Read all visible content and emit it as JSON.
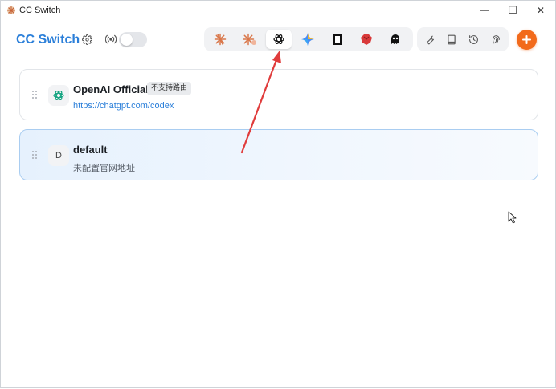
{
  "window": {
    "title": "CC Switch",
    "minimize_glyph": "—",
    "maximize_glyph": "☐",
    "close_glyph": "✕"
  },
  "header": {
    "brand": "CC Switch",
    "settings_icon": "gear-icon",
    "proxy_icon": "broadcast-icon",
    "proxy_toggle_on": false
  },
  "apps": [
    {
      "name": "claude",
      "icon": "claude-icon",
      "active": false
    },
    {
      "name": "claude-alt",
      "icon": "claude-alt-icon",
      "active": false
    },
    {
      "name": "openai",
      "icon": "openai-icon",
      "active": true
    },
    {
      "name": "gemini",
      "icon": "gemini-icon",
      "active": false
    },
    {
      "name": "opencode",
      "icon": "opencode-icon",
      "active": false
    },
    {
      "name": "redbird",
      "icon": "red-bird-icon",
      "active": false
    },
    {
      "name": "ghost",
      "icon": "ghost-icon",
      "active": false
    }
  ],
  "tools": [
    {
      "icon": "wrench-icon"
    },
    {
      "icon": "book-icon"
    },
    {
      "icon": "history-icon"
    },
    {
      "icon": "fingerprint-icon"
    }
  ],
  "add_icon": "plus-icon",
  "providers": [
    {
      "name": "OpenAI Official",
      "badge": "不支持路由",
      "link": "https://chatgpt.com/codex",
      "avatar_icon": "openai-icon",
      "selected": false
    },
    {
      "name": "default",
      "avatar_letter": "D",
      "subtitle": "未配置官网地址",
      "selected": true
    }
  ],
  "colors": {
    "brand": "#2b7fd9",
    "accent": "#f26a1b",
    "selected_border": "#a9cdf1",
    "annotation_arrow": "#e03c3c"
  }
}
